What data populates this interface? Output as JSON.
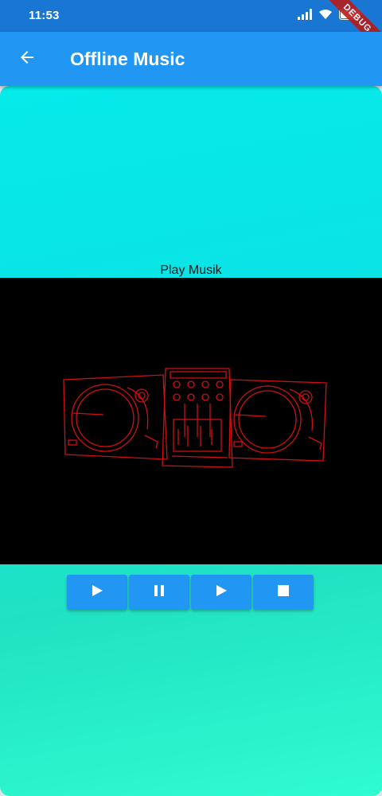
{
  "status_bar": {
    "time": "11:53",
    "battery": "99",
    "icons": [
      "signal-icon",
      "wifi-icon",
      "battery-icon"
    ]
  },
  "debug_ribbon": "DEBUG",
  "app_bar": {
    "title": "Offline Music",
    "back_icon": "arrow-back-icon"
  },
  "main": {
    "label": "Play Musik",
    "controls": [
      {
        "icon": "play-icon"
      },
      {
        "icon": "pause-icon"
      },
      {
        "icon": "play-icon"
      },
      {
        "icon": "stop-icon"
      }
    ]
  },
  "colors": {
    "status_bar": "#1976d2",
    "app_bar": "#2196f3",
    "card_top": "#06eaea",
    "card_bottom": "#2ffcd0",
    "illustration": "#d01010"
  }
}
